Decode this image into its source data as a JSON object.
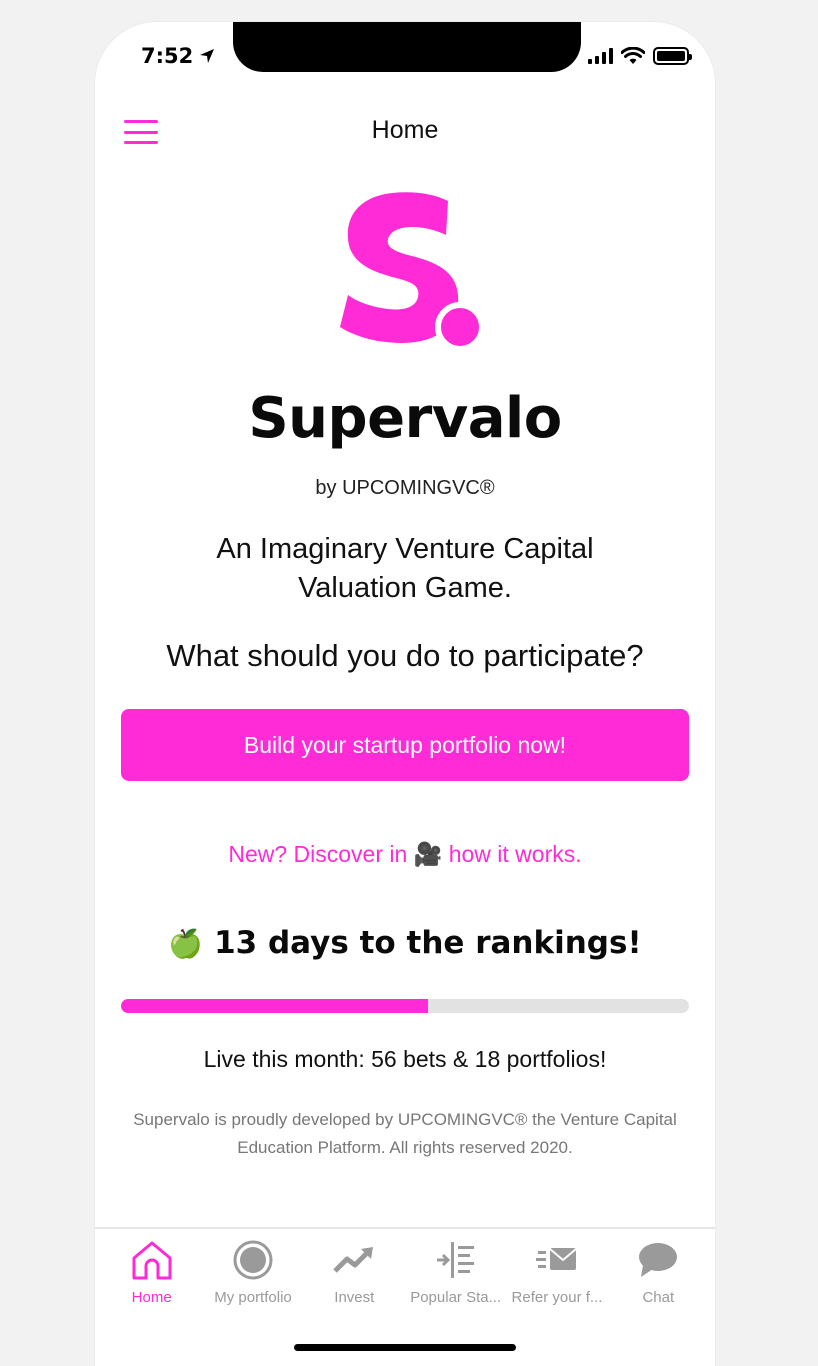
{
  "status_bar": {
    "time": "7:52"
  },
  "header": {
    "title": "Home"
  },
  "brand": {
    "name": "Supervalo",
    "by_line": "by UPCOMINGVC®",
    "tagline": "An Imaginary Venture Capital Valuation Game.",
    "accent_color": "#ff2bd6"
  },
  "main": {
    "question": "What should you do to participate?",
    "cta_label": "Build your startup portfolio now!",
    "discover_link": "New? Discover in 🎥 how it works.",
    "countdown": {
      "emoji": "🍏",
      "text": "13 days to the rankings!",
      "progress_fraction": 0.54
    },
    "live_stats": "Live this month: 56 bets & 18 portfolios!",
    "footer_note": "Supervalo is proudly developed by UPCOMINGVC® the Venture Capital Education Platform. All rights reserved 2020."
  },
  "tabbar": {
    "items": [
      {
        "label": "Home",
        "icon": "home-icon",
        "active": true
      },
      {
        "label": "My portfolio",
        "icon": "record-circle-icon",
        "active": false
      },
      {
        "label": "Invest",
        "icon": "trending-up-icon",
        "active": false
      },
      {
        "label": "Popular Sta...",
        "icon": "list-arrow-icon",
        "active": false
      },
      {
        "label": "Refer your f...",
        "icon": "send-mail-icon",
        "active": false
      },
      {
        "label": "Chat",
        "icon": "chat-bubble-icon",
        "active": false
      }
    ]
  }
}
